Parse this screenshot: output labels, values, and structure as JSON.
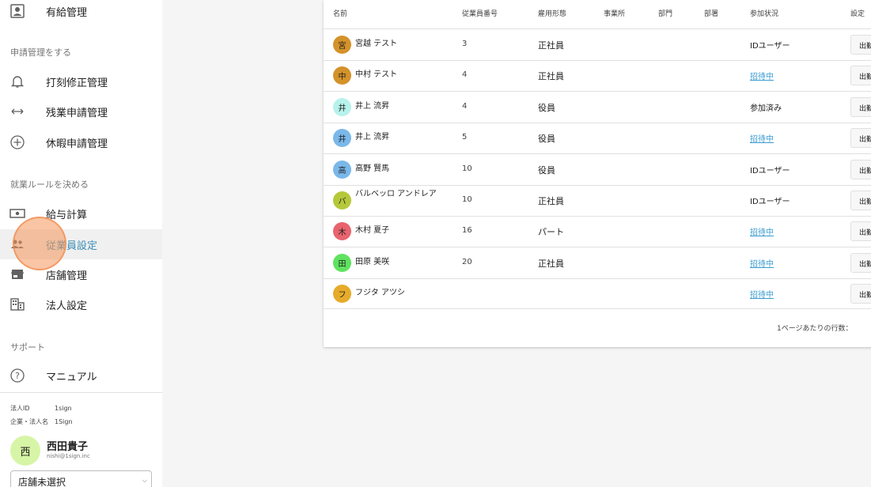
{
  "sidebar": {
    "top_item": {
      "label": "有給管理",
      "icon": "person-badge-icon"
    },
    "sections": [
      {
        "label": "申請管理をする"
      },
      {
        "label": "就業ルールを決める"
      },
      {
        "label": "サポート"
      }
    ],
    "request_items": [
      {
        "label": "打刻修正管理",
        "icon": "bell-icon"
      },
      {
        "label": "残業申請管理",
        "icon": "left-right-arrow-icon"
      },
      {
        "label": "休暇申請管理",
        "icon": "plus-circle-icon"
      }
    ],
    "rule_items": [
      {
        "label": "給与計算",
        "icon": "cash-icon"
      },
      {
        "label": "従業員設定",
        "icon": "people-icon",
        "active": true
      },
      {
        "label": "店舗管理",
        "icon": "store-icon"
      },
      {
        "label": "法人設定",
        "icon": "building-icon"
      }
    ],
    "support_items": [
      {
        "label": "マニュアル",
        "icon": "question-circle-icon"
      }
    ],
    "corp": {
      "id_label": "法人ID",
      "id_value": "1sign",
      "name_label": "企業・法人名",
      "name_value": "1Sign"
    },
    "user": {
      "avatar": "西",
      "name": "西田貴子",
      "email": "nishi@1sign.inc",
      "avatar_color": "#d7f5a6"
    },
    "store_select": {
      "value": "店舗未選択"
    }
  },
  "table": {
    "columns": [
      "名前",
      "従業員番号",
      "雇用形態",
      "事業所",
      "部門",
      "部署",
      "参加状況",
      "設定"
    ],
    "rows": [
      {
        "avatar": "宮",
        "avatar_color": "#d4922a",
        "name": "宮越 テスト",
        "number": "3",
        "employment": "正社員",
        "status": "IDユーザー",
        "status_link": false,
        "action": "出勤"
      },
      {
        "avatar": "中",
        "avatar_color": "#d4922a",
        "name": "中村 テスト",
        "number": "4",
        "employment": "正社員",
        "status": "招待中",
        "status_link": true,
        "action": "出勤"
      },
      {
        "avatar": "井",
        "avatar_color": "#b7f2ec",
        "name": "井上 流昇",
        "number": "4",
        "employment": "役員",
        "status": "参加済み",
        "status_link": false,
        "action": "出勤"
      },
      {
        "avatar": "井",
        "avatar_color": "#7ab8ea",
        "name": "井上 流昇",
        "number": "5",
        "employment": "役員",
        "status": "招待中",
        "status_link": true,
        "action": "出勤"
      },
      {
        "avatar": "高",
        "avatar_color": "#7ab8ea",
        "name": "高野 賢馬",
        "number": "10",
        "employment": "役員",
        "status": "IDユーザー",
        "status_link": false,
        "action": "出勤"
      },
      {
        "avatar": "バ",
        "avatar_color": "#b5c83a",
        "name": "バルベッロ アンドレア",
        "number": "10",
        "employment": "正社員",
        "status": "IDユーザー",
        "status_link": false,
        "action": "出勤"
      },
      {
        "avatar": "木",
        "avatar_color": "#e8646e",
        "name": "木村 夏子",
        "number": "16",
        "employment": "パート",
        "status": "招待中",
        "status_link": true,
        "action": "出勤"
      },
      {
        "avatar": "田",
        "avatar_color": "#5fe35f",
        "name": "田原 美咲",
        "number": "20",
        "employment": "正社員",
        "status": "招待中",
        "status_link": true,
        "action": "出勤"
      },
      {
        "avatar": "フ",
        "avatar_color": "#e6ab2a",
        "name": "フジタ アツシ",
        "number": "",
        "employment": "",
        "status": "招待中",
        "status_link": true,
        "action": "出勤"
      }
    ],
    "rows_per_page_label": "1ページあたりの行数："
  },
  "colors": {
    "accent": "#3a8fb7",
    "link": "#3a9bd1"
  }
}
